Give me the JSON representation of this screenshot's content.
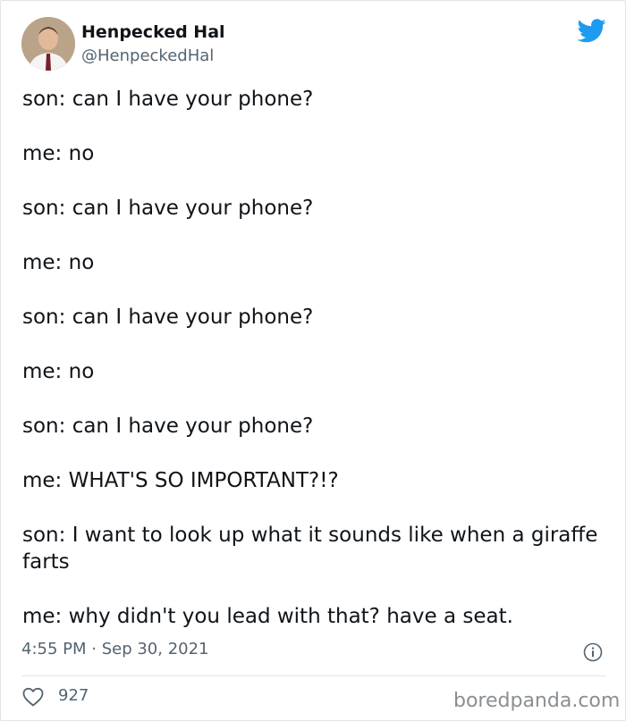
{
  "author": {
    "display_name": "Henpecked Hal",
    "handle": "@HenpeckedHal",
    "avatar_icon": "profile-photo"
  },
  "platform_icon": "twitter-bird-icon",
  "brand_color": "#1d9bf0",
  "tweet": {
    "lines": [
      "son: can I have your phone?",
      "me: no",
      "son: can I have your phone?",
      "me: no",
      "son: can I have your phone?",
      "me: no",
      "son: can I have your phone?",
      "me: WHAT'S SO IMPORTANT?!?",
      "son: I want to look up what it sounds like when a giraffe farts",
      "me: why didn't you lead with that? have a seat."
    ]
  },
  "meta": {
    "timestamp": "4:55 PM · Sep 30, 2021"
  },
  "engagement": {
    "likes": "927"
  },
  "watermark": "boredpanda.com"
}
